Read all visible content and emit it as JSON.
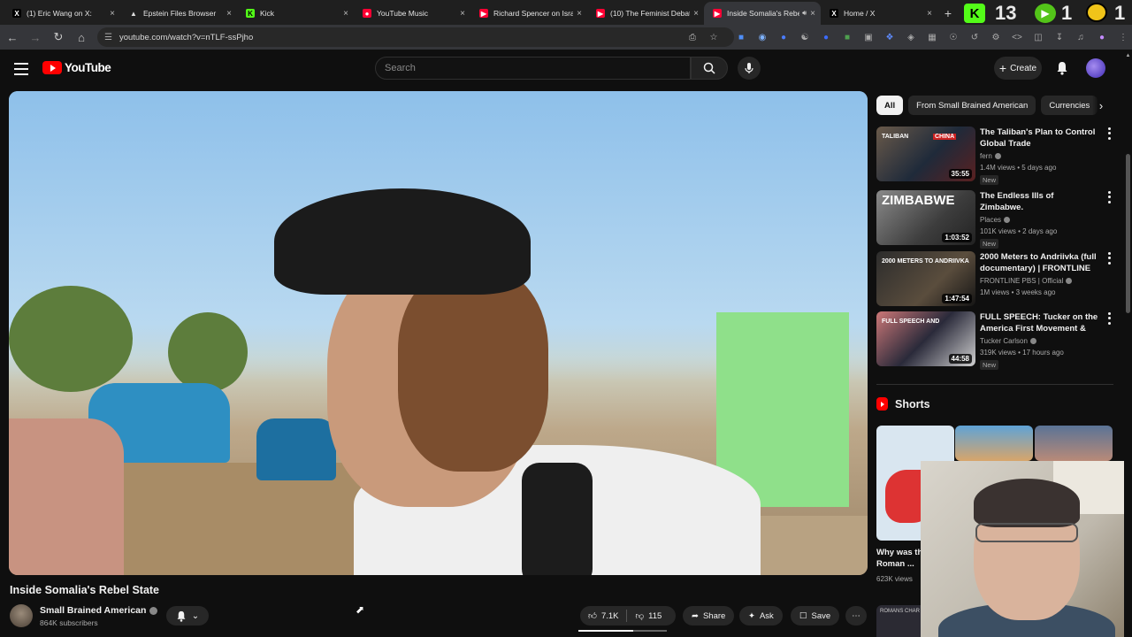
{
  "browser": {
    "tabs": [
      {
        "label": "(1) Eric Wang on X:",
        "favicon": "x-icon",
        "active": false
      },
      {
        "label": "Epstein Files Browser",
        "favicon": "triangle-icon",
        "active": false
      },
      {
        "label": "Kick",
        "favicon": "kick-icon",
        "active": false
      },
      {
        "label": "YouTube Music",
        "favicon": "youtube-music-icon",
        "active": false
      },
      {
        "label": "Richard Spencer on Isra",
        "favicon": "youtube-icon",
        "active": false
      },
      {
        "label": "(10) The Feminist Debat",
        "favicon": "youtube-icon",
        "active": false
      },
      {
        "label": "Inside Somalia's Rebel",
        "favicon": "youtube-icon",
        "active": true
      },
      {
        "label": "Home / X",
        "favicon": "x-icon",
        "active": false
      }
    ],
    "new_tab": "+",
    "overlay_number_1": "13",
    "overlay_number_2": "1",
    "overlay_number_3": "1",
    "url": "youtube.com/watch?v=nTLF-ssPjho"
  },
  "youtube": {
    "logo_text": "YouTube",
    "search_placeholder": "Search",
    "create_label": "Create"
  },
  "video": {
    "title": "Inside Somalia's Rebel State",
    "channel": "Small Brained American",
    "subscribers": "864K subscribers",
    "likes": "7.1K",
    "dislikes": "115",
    "share": "Share",
    "ask": "Ask",
    "save": "Save",
    "like_ratio": 0.62
  },
  "sidebar": {
    "chips": [
      "All",
      "From Small Brained American",
      "Currencies"
    ],
    "recommendations": [
      {
        "title": "The Taliban's Plan to Control Global Trade",
        "channel": "fern",
        "meta": "1.4M views • 5 days ago",
        "badge": "New",
        "duration": "35:55",
        "thumb_text": "TALIBAN",
        "thumb_text2": "CHINA"
      },
      {
        "title": "The Endless Ills of Zimbabwe.",
        "channel": "Places",
        "meta": "101K views • 2 days ago",
        "badge": "New",
        "duration": "1:03:52",
        "thumb_text": "ZIMBABWE",
        "thumb_text2": ""
      },
      {
        "title": "2000 Meters to Andriivka (full documentary) | FRONTLINE",
        "channel": "FRONTLINE PBS | Official",
        "meta": "1M views • 3 weeks ago",
        "badge": "",
        "duration": "1:47:54",
        "thumb_text": "2000 METERS TO ANDRIIVKA",
        "thumb_text2": ""
      },
      {
        "title": "FULL SPEECH: Tucker on the America First Movement & Ne...",
        "channel": "Tucker Carlson",
        "meta": "319K views • 17 hours ago",
        "badge": "New",
        "duration": "44:58",
        "thumb_text": "FULL SPEECH AND",
        "thumb_text2": ""
      }
    ],
    "shorts_title": "Shorts",
    "short": {
      "title": "Why was th Roman ...",
      "views": "623K views"
    },
    "short4_text": "ROMANS CHAR"
  }
}
